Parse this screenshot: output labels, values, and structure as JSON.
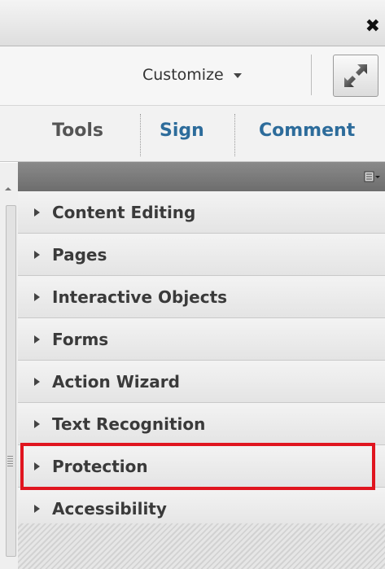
{
  "titlebar": {
    "close_glyph": "✖",
    "close_icon": "close-icon"
  },
  "toolbar": {
    "customize_label": "Customize",
    "expand_icon": "expand-arrows-icon"
  },
  "tabs": [
    {
      "label": "Tools"
    },
    {
      "label": "Sign"
    },
    {
      "label": "Comment"
    }
  ],
  "panel": {
    "menu_icon": "panel-options-icon",
    "items": [
      {
        "label": "Content Editing"
      },
      {
        "label": "Pages"
      },
      {
        "label": "Interactive Objects"
      },
      {
        "label": "Forms"
      },
      {
        "label": "Action Wizard"
      },
      {
        "label": "Text Recognition"
      },
      {
        "label": "Protection",
        "highlighted": true
      },
      {
        "label": "Accessibility"
      }
    ]
  },
  "colors": {
    "tab_active": "#2d6c9b",
    "tab_inactive": "#555555",
    "highlight": "#e0151f"
  }
}
